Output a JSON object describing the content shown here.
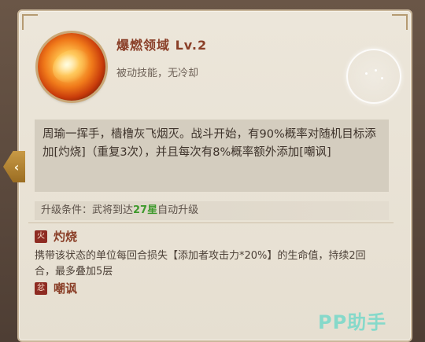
{
  "skill": {
    "name": "爆燃领域  Lv.2",
    "type": "被动技能，无冷却",
    "icon": "flame-orb-icon",
    "description": "周瑜一挥手，樯橹灰飞烟灭。战斗开始，有90%概率对随机目标添加[灼烧]（重复3次），并且每次有8%概率额外添加[嘲讽]"
  },
  "upgrade": {
    "prefix": "升级条件：武将到达",
    "star_value": "27星",
    "suffix": "自动升级"
  },
  "statuses": [
    {
      "name": "灼烧",
      "icon": "burn-status-icon",
      "glyph": "火"
    },
    {
      "name": "嘲讽",
      "icon": "taunt-status-icon",
      "glyph": "忿"
    }
  ],
  "burn_description": "携带该状态的单位每回合损失【添加者攻击力*20%】的生命值，持续2回合，最多叠加5层",
  "nav": {
    "prev_arrow": "‹"
  },
  "watermark": "PP助手",
  "colors": {
    "accent": "#8a3f28",
    "star": "#3f9a2d",
    "panel": "#e9e3d6"
  }
}
